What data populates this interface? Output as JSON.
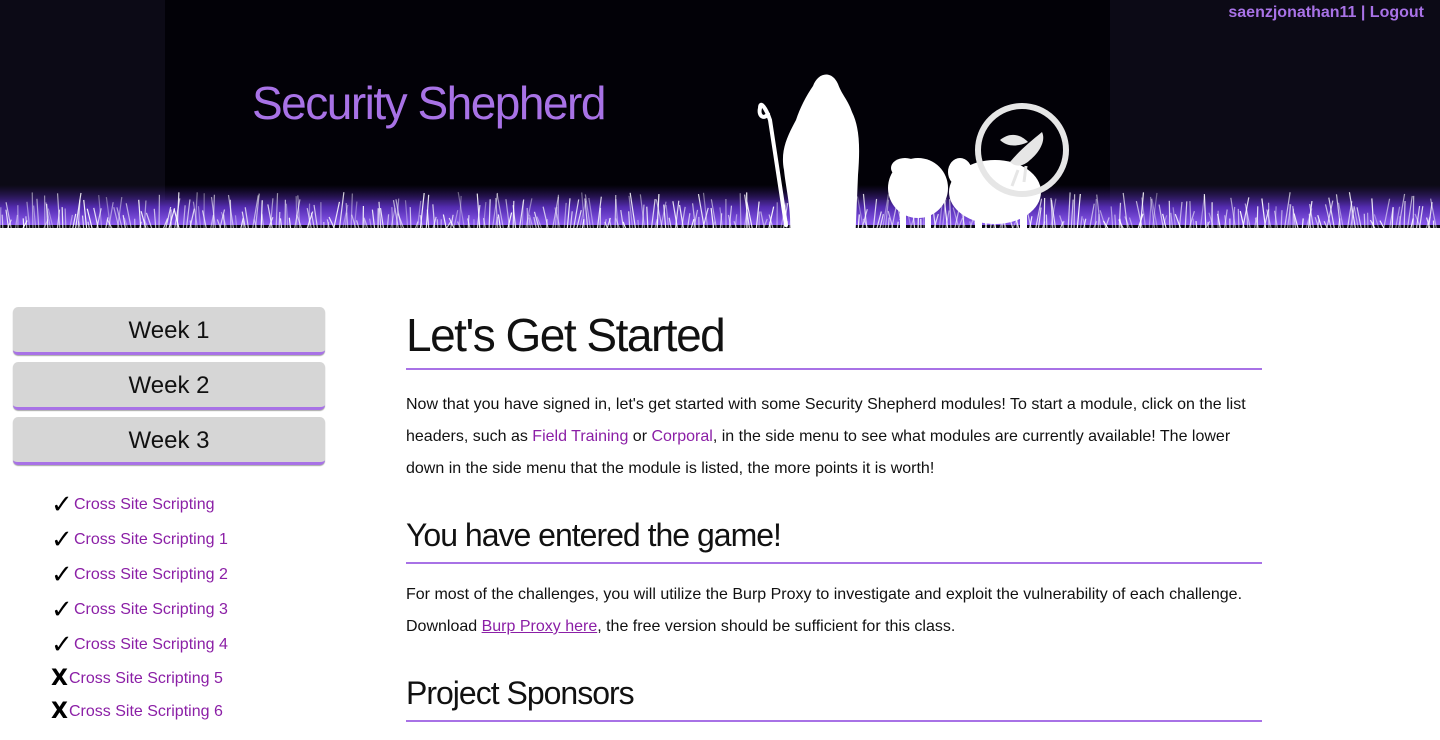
{
  "header": {
    "site_title": "Security Shepherd",
    "username": "saenzjonathan11",
    "separator": " | ",
    "logout_label": "Logout"
  },
  "sidebar": {
    "weeks": [
      {
        "label": "Week 1"
      },
      {
        "label": "Week 2"
      },
      {
        "label": "Week 3"
      }
    ],
    "modules": [
      {
        "label": "Cross Site Scripting",
        "status": "completed",
        "mark": "✓"
      },
      {
        "label": "Cross Site Scripting 1",
        "status": "completed",
        "mark": "✓"
      },
      {
        "label": "Cross Site Scripting 2",
        "status": "completed",
        "mark": "✓"
      },
      {
        "label": "Cross Site Scripting 3",
        "status": "completed",
        "mark": "✓"
      },
      {
        "label": "Cross Site Scripting 4",
        "status": "completed",
        "mark": "✓"
      },
      {
        "label": "Cross Site Scripting 5",
        "status": "incomplete",
        "mark": "X"
      },
      {
        "label": "Cross Site Scripting 6",
        "status": "incomplete",
        "mark": "X"
      }
    ]
  },
  "main": {
    "heading": "Let's Get Started",
    "intro": {
      "part1": "Now that you have signed in, let's get started with some Security Shepherd modules! To start a module, click on the list headers, such as ",
      "link1": "Field Training",
      "part2": " or ",
      "link2": "Corporal",
      "part3": ", in the side menu to see what modules are currently available! The lower down in the side menu that the module is listed, the more points it is worth!"
    },
    "game_heading": "You have entered the game!",
    "game_text": {
      "part1": "For most of the challenges, you will utilize the Burp Proxy to investigate and exploit the vulnerability of each challenge. Download ",
      "link": "Burp Proxy here",
      "part2": ", the free version should be sufficient for this class."
    },
    "sponsors_heading": "Project Sponsors"
  },
  "colors": {
    "accent": "#a872e6",
    "link": "#8b1fa6",
    "banner_dark": "#020107",
    "banner_side": "#0c0a16"
  },
  "icons": {
    "shepherd_logo": "shepherd-silhouette-icon",
    "owasp_logo": "owasp-wasp-icon",
    "completed": "checkmark-icon",
    "incomplete": "cross-icon"
  }
}
